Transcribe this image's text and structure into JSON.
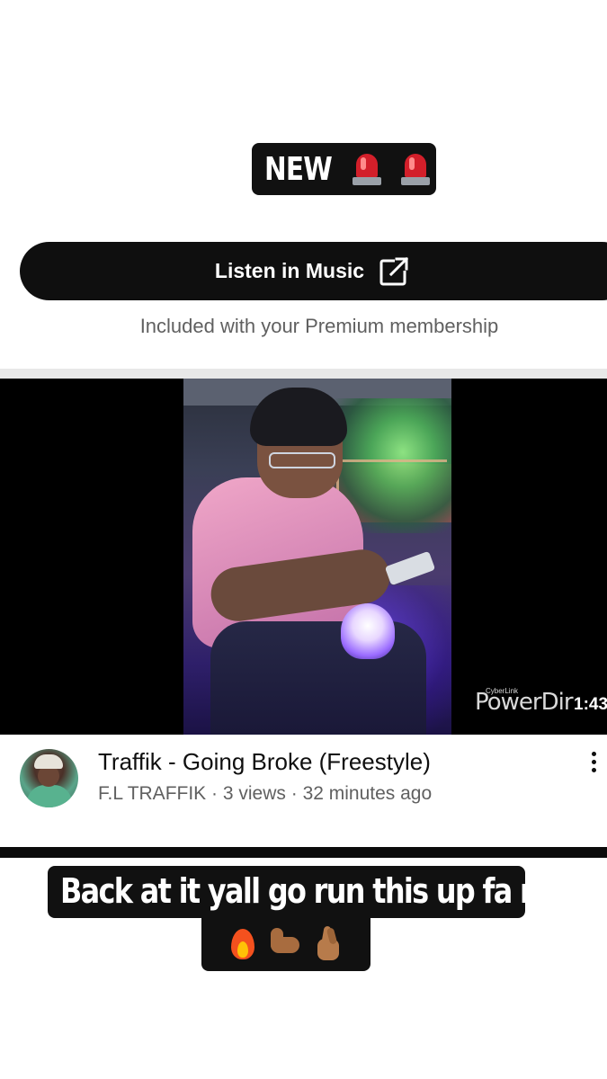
{
  "story": {
    "top_caption": "NEW",
    "top_emojis": [
      "police-light-icon",
      "police-light-icon"
    ],
    "bottom_caption": "Back at  it  yall go run this up fa me",
    "bottom_emojis": [
      "fire-icon",
      "flexed-biceps-icon",
      "crossed-fingers-icon"
    ]
  },
  "music": {
    "button_label": "Listen in Music",
    "button_icon": "external-link-icon",
    "premium_note": "Included with your Premium membership"
  },
  "video": {
    "watermark_small": "CyberLink",
    "watermark": "PowerDir",
    "duration": "1:43",
    "title": "Traffik - Going Broke (Freestyle)",
    "channel": "F.L TRAFFIK",
    "views": "3 views",
    "age": "32 minutes ago",
    "meta_separator": " · "
  },
  "colors": {
    "caption_bg": "#111111",
    "button_bg": "#0f0f0f",
    "secondary_text": "#606060"
  }
}
